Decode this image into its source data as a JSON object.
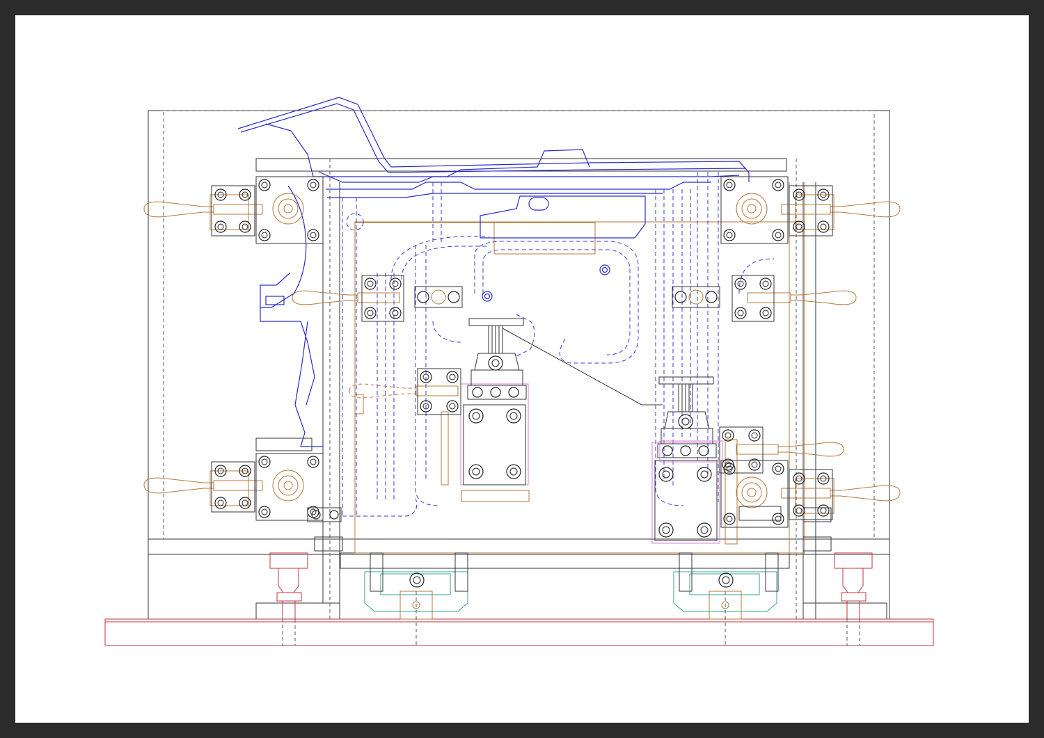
{
  "drawing": {
    "colors": {
      "frame": "#2b2b2b",
      "paper": "#ffffff",
      "base_structure": "#333333",
      "part_outline": "#2a2acf",
      "clamps": "#b47a3c",
      "base_plate": "#c8323c",
      "locator_blocks": "#d77fd2",
      "slide_units": "#3aa096"
    },
    "components": [
      {
        "id": "workpiece",
        "label": "sheet-metal-part"
      },
      {
        "id": "toggle-clamps",
        "count": 8
      },
      {
        "id": "locating-pins",
        "count": 2
      },
      {
        "id": "base-plate",
        "count": 1
      },
      {
        "id": "slide-units",
        "count": 2
      },
      {
        "id": "leveling-feet",
        "count": 2
      }
    ]
  }
}
